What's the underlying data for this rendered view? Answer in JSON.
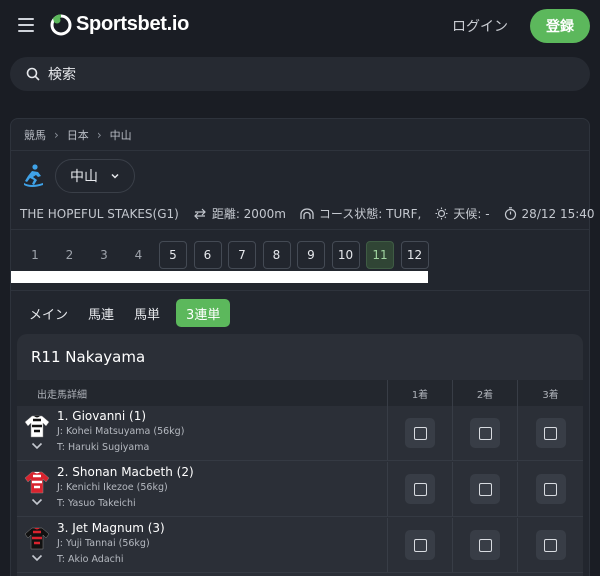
{
  "header": {
    "brand": "Sportsbet.io",
    "login_label": "ログイン",
    "register_label": "登録",
    "accent_color": "#5cb85c"
  },
  "search": {
    "label": "検索"
  },
  "breadcrumb": [
    "競馬",
    "日本",
    "中山"
  ],
  "venue": {
    "selected": "中山"
  },
  "race_info": {
    "name": "THE HOPEFUL STAKES(G1)",
    "distance": "距離: 2000m",
    "course": "コース状態: TURF,",
    "weather": "天候: -",
    "time": "28/12 15:40"
  },
  "race_numbers": [
    {
      "label": "1",
      "style": "plain"
    },
    {
      "label": "2",
      "style": "plain"
    },
    {
      "label": "3",
      "style": "plain"
    },
    {
      "label": "4",
      "style": "plain"
    },
    {
      "label": "5",
      "style": "boxed"
    },
    {
      "label": "6",
      "style": "boxed"
    },
    {
      "label": "7",
      "style": "boxed"
    },
    {
      "label": "8",
      "style": "boxed"
    },
    {
      "label": "9",
      "style": "boxed"
    },
    {
      "label": "10",
      "style": "boxed"
    },
    {
      "label": "11",
      "style": "active"
    },
    {
      "label": "12",
      "style": "boxed"
    }
  ],
  "tabs": [
    "メイン",
    "馬連",
    "馬単",
    "3連単"
  ],
  "active_tab": "3連単",
  "card": {
    "title": "R11 Nakayama",
    "columns": [
      "出走馬詳細",
      "1着",
      "2着",
      "3着"
    ]
  },
  "runners": [
    {
      "name": "1. Giovanni (1)",
      "jockey": "J: Kohei Matsuyama (56kg)",
      "trainer": "T: Haruki Sugiyama",
      "silk_colors": [
        "#ffffff",
        "#111111"
      ]
    },
    {
      "name": "2. Shonan Macbeth (2)",
      "jockey": "J: Kenichi Ikezoe (56kg)",
      "trainer": "T: Yasuo Takeichi",
      "silk_colors": [
        "#d9232e",
        "#ffffff"
      ]
    },
    {
      "name": "3. Jet Magnum (3)",
      "jockey": "J: Yuji Tannai (56kg)",
      "trainer": "T: Akio Adachi",
      "silk_colors": [
        "#111111",
        "#d9232e"
      ]
    }
  ]
}
